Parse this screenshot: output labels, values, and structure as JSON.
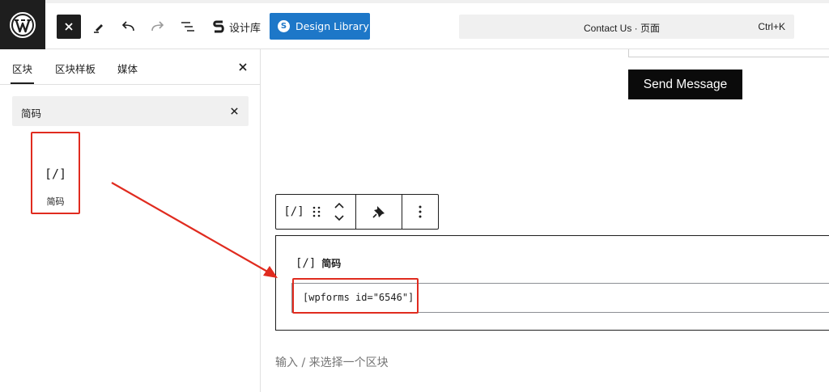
{
  "topbar": {
    "wp_logo_icon": "wordpress-logo-icon",
    "close_icon": "close-icon",
    "tools": [
      "pencil-icon",
      "undo-icon",
      "redo-icon",
      "list-view-icon"
    ],
    "library_icon": "stackable-s-icon",
    "library_label": "设计库",
    "design_library_label": "Design Library",
    "command_bar_title": "Contact Us · 页面",
    "command_bar_shortcut": "Ctrl+K",
    "brand_color": "#1d77c8"
  },
  "sidebar": {
    "tabs": [
      {
        "label": "区块",
        "active": true
      },
      {
        "label": "区块样板",
        "active": false
      },
      {
        "label": "媒体",
        "active": false
      }
    ],
    "search_value": "简码",
    "result": {
      "icon_text": "[/]",
      "label": "简码"
    }
  },
  "canvas": {
    "send_button_label": "Send Message",
    "toolbar": {
      "block_icon_text": "[/]",
      "drag_icon": "drag-handle-icon",
      "move_icon": "move-up-down-icon",
      "transform_icon": "pin-icon",
      "options_icon": "more-vertical-icon"
    },
    "shortcode_block": {
      "icon_text": "[/]",
      "title": "简码",
      "value": "[wpforms id=\"6546\"]"
    },
    "appender_placeholder": "输入 / 来选择一个区块"
  },
  "highlight_color": "#e02b1f"
}
